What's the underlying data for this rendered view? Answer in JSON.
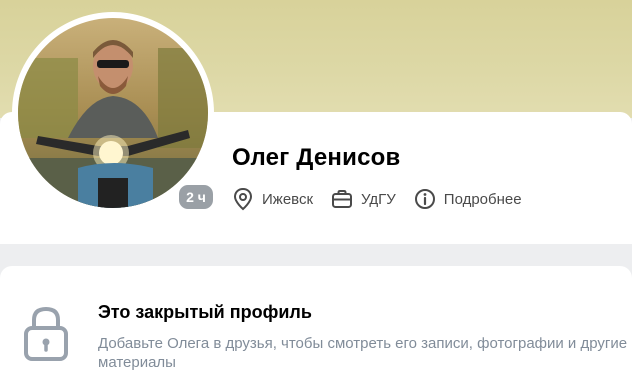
{
  "profile": {
    "name": "Олег Денисов",
    "online_badge": "2 ч",
    "city": "Ижевск",
    "education": "УдГУ",
    "more_label": "Подробнее"
  },
  "closed_profile": {
    "title": "Это закрытый профиль",
    "description": "Добавьте Олега в друзья, чтобы смотреть его записи, фотографии и другие материалы"
  },
  "colors": {
    "cover": "#dcd6a2",
    "badge": "#9aa0a6",
    "secondary_text": "#818c99",
    "icon": "#4a4a4a"
  },
  "icons": {
    "city": "location-pin-icon",
    "education": "briefcase-icon",
    "more": "info-icon",
    "closed": "lock-icon"
  }
}
